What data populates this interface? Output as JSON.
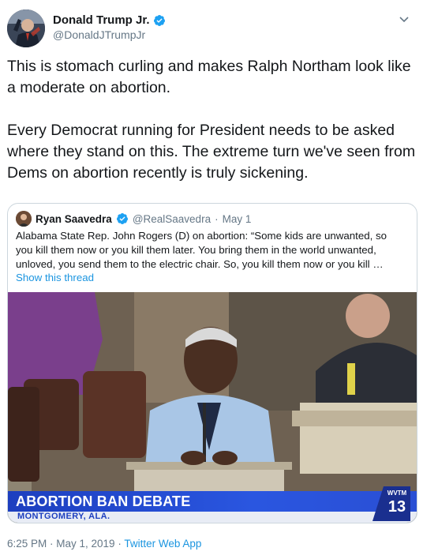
{
  "author": {
    "display_name": "Donald Trump Jr.",
    "handle": "@DonaldJTrumpJr",
    "verified": true,
    "verified_color": "#1da1f2"
  },
  "tweet": {
    "paragraphs": [
      "This is stomach curling and makes Ralph Northam look like a moderate on abortion.",
      "Every Democrat running for President needs to be asked where they stand on this. The extreme turn we've seen from Dems on abortion recently is truly sickening."
    ]
  },
  "quoted": {
    "display_name": "Ryan Saavedra",
    "handle": "@RealSaavedra",
    "separator": "·",
    "date": "May 1",
    "lines": [
      "Alabama State Rep. John Rogers (D) on abortion: “Some kids are unwanted, so",
      "you kill them now or you kill them later. You bring them in the world unwanted,",
      "unloved, you send them to the electric chair. So, you kill them now or you kill …"
    ],
    "show_thread": "Show this thread",
    "video": {
      "title": "ABORTION BAN DEBATE",
      "subtitle": "MONTGOMERY, ALA.",
      "station_top": "WVTM",
      "station_num": "13"
    }
  },
  "footer": {
    "timestamp": "6:25 PM · May 1, 2019 · ",
    "source": "Twitter Web App"
  },
  "colors": {
    "link": "#1b95e0",
    "muted": "#657786",
    "border": "#ccd6dd",
    "lower_third_blue": "#1d3fbf"
  }
}
